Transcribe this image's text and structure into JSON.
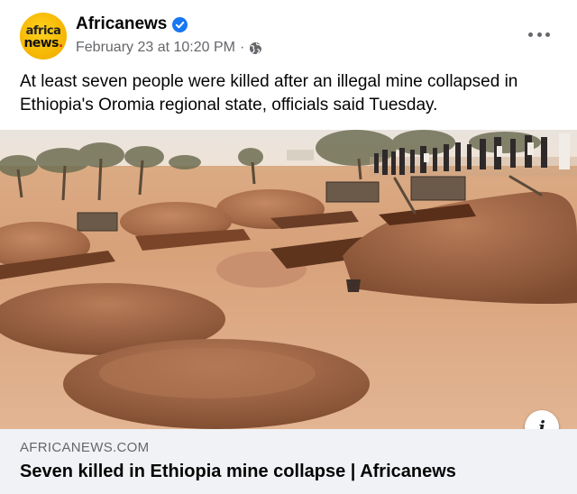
{
  "post": {
    "page_name": "Africanews",
    "verified": true,
    "timestamp": "February 23 at 10:20 PM",
    "separator": "·",
    "audience_icon": "globe-icon",
    "more_icon": "more-options-icon",
    "text": "At least seven people were killed after an illegal mine collapsed in Ethiopia's Oromia regional state, officials said Tuesday.",
    "avatar": {
      "line1": "africa",
      "line2": "news",
      "dot": "."
    }
  },
  "link": {
    "domain": "AFRICANEWS.COM",
    "headline": "Seven killed in Ethiopia mine collapse | Africanews",
    "info_icon": "i"
  },
  "colors": {
    "accent": "#1877f2",
    "secondary_text": "#65676b",
    "preview_bg": "#f0f2f5",
    "logo_yellow": "#f4b400"
  }
}
